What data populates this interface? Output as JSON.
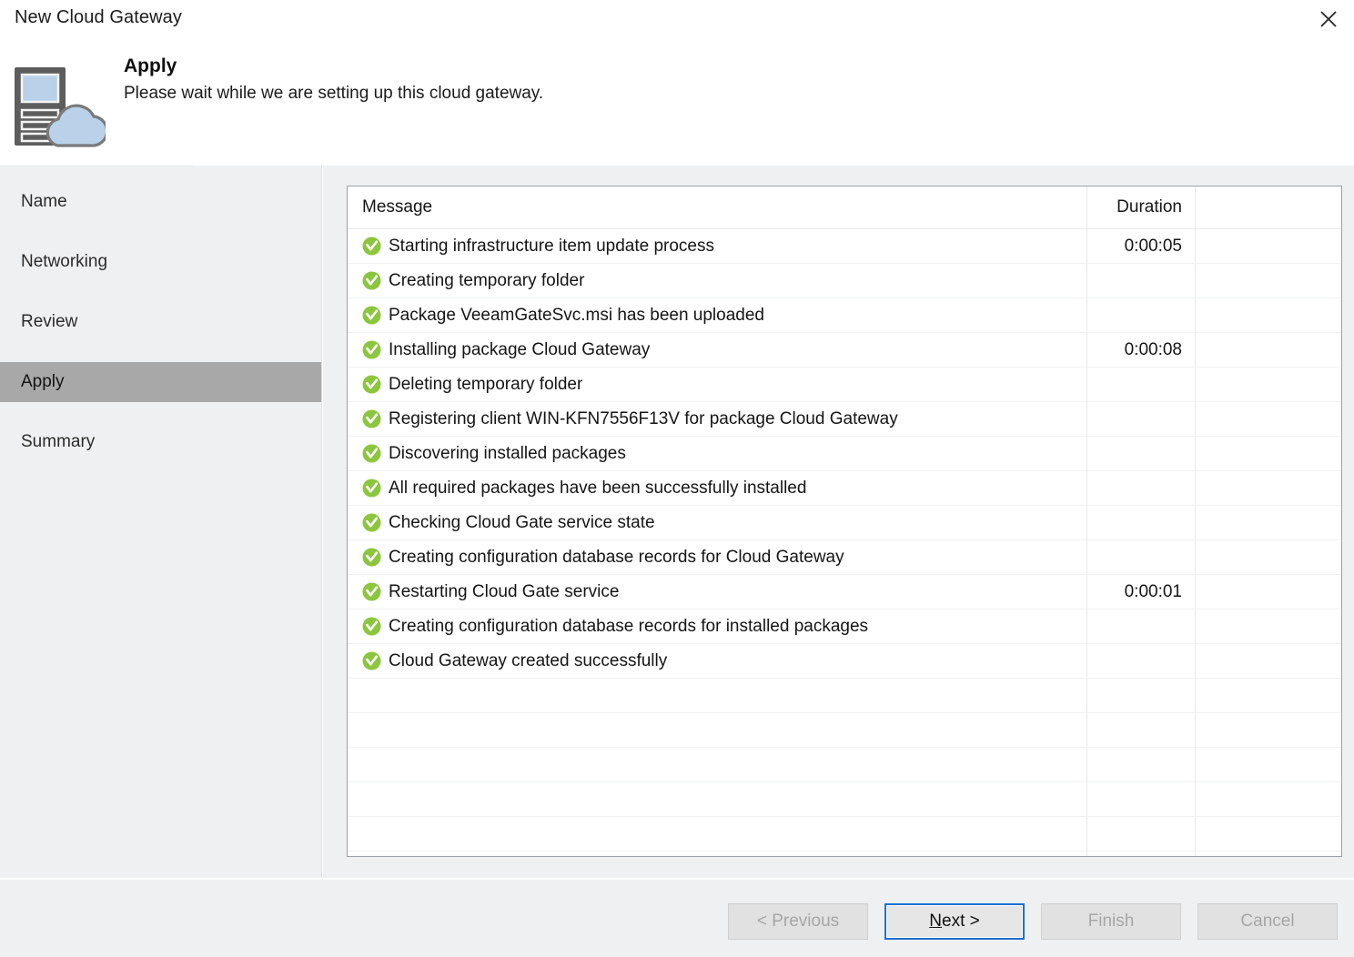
{
  "window": {
    "title": "New Cloud Gateway",
    "close_icon": "close-icon"
  },
  "header": {
    "icon": "cloud-gateway-icon",
    "title": "Apply",
    "subtitle": "Please wait while we are setting up this cloud gateway."
  },
  "sidebar": {
    "items": [
      {
        "label": "Name",
        "selected": false
      },
      {
        "label": "Networking",
        "selected": false
      },
      {
        "label": "Review",
        "selected": false
      },
      {
        "label": "Apply",
        "selected": true
      },
      {
        "label": "Summary",
        "selected": false
      }
    ]
  },
  "grid": {
    "columns": [
      "Message",
      "Duration",
      ""
    ],
    "status_icon": "success-check-icon",
    "rows": [
      {
        "message": "Starting infrastructure item update process",
        "duration": "0:00:05"
      },
      {
        "message": "Creating temporary folder",
        "duration": ""
      },
      {
        "message": "Package VeeamGateSvc.msi has been uploaded",
        "duration": ""
      },
      {
        "message": "Installing package Cloud Gateway",
        "duration": "0:00:08"
      },
      {
        "message": "Deleting temporary folder",
        "duration": ""
      },
      {
        "message": "Registering client WIN-KFN7556F13V for package Cloud Gateway",
        "duration": ""
      },
      {
        "message": "Discovering installed packages",
        "duration": ""
      },
      {
        "message": "All required packages have been successfully installed",
        "duration": ""
      },
      {
        "message": "Checking Cloud Gate service state",
        "duration": ""
      },
      {
        "message": "Creating configuration database records for Cloud Gateway",
        "duration": ""
      },
      {
        "message": "Restarting Cloud Gate service",
        "duration": "0:00:01"
      },
      {
        "message": "Creating configuration database records for installed packages",
        "duration": ""
      },
      {
        "message": "Cloud Gateway created successfully",
        "duration": ""
      }
    ],
    "empty_row_count": 5
  },
  "footer": {
    "buttons": [
      {
        "id": "previous",
        "label": "< Previous",
        "enabled": false
      },
      {
        "id": "next",
        "label": "Next >",
        "accel": "N",
        "enabled": true
      },
      {
        "id": "finish",
        "label": "Finish",
        "enabled": false
      },
      {
        "id": "cancel",
        "label": "Cancel",
        "enabled": false
      }
    ]
  },
  "colors": {
    "selected_nav": "#a8a8a8",
    "focus_border": "#1f6fd0",
    "success_green": "#8cc63e",
    "panel_bg": "#eff0f1",
    "icon_dark": "#5d5d5d",
    "icon_blue": "#b9d2ea"
  }
}
